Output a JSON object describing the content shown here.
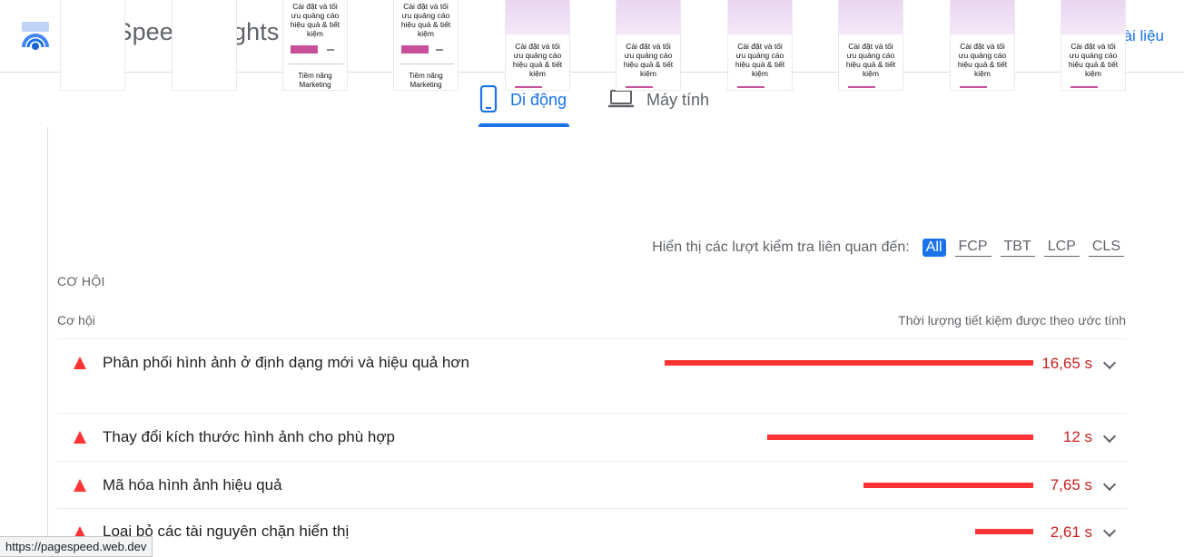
{
  "header": {
    "title": "PageSpeed Insights",
    "docs_link": "Tài liệu"
  },
  "tabs": [
    {
      "label": "Di động",
      "icon": "phone-icon",
      "active": true
    },
    {
      "label": "Máy tính",
      "icon": "laptop-icon",
      "active": false
    }
  ],
  "filmstrip": {
    "frame_text": "Cài đặt và tối ưu quảng cáo hiệu quả & tiết kiệm",
    "frame_footer": "Tiềm năng Marketing Online"
  },
  "filter": {
    "label": "Hiển thị các lượt kiểm tra liên quan đến:",
    "options": [
      "All",
      "FCP",
      "TBT",
      "LCP",
      "CLS"
    ],
    "active": "All"
  },
  "opportunities": {
    "section_title": "CƠ HỘI",
    "col_left": "Cơ hội",
    "col_right": "Thời lượng tiết kiệm được theo ước tính",
    "items": [
      {
        "label": "Phân phối hình ảnh ở định dạng mới và hiệu quả hơn",
        "value": "16,65 s",
        "savings_s": 16.65
      },
      {
        "label": "Thay đổi kích thước hình ảnh cho phù hợp",
        "value": "12 s",
        "savings_s": 12
      },
      {
        "label": "Mã hóa hình ảnh hiệu quả",
        "value": "7,65 s",
        "savings_s": 7.65
      },
      {
        "label": "Loại bỏ các tài nguyên chặn hiển thị",
        "value": "2,61 s",
        "savings_s": 2.61
      }
    ]
  },
  "colors": {
    "accent": "#1a73e8",
    "fail": "#ff3333",
    "fail_text": "#c5221f"
  },
  "status_bar": {
    "url": "https://pagespeed.web.dev"
  }
}
